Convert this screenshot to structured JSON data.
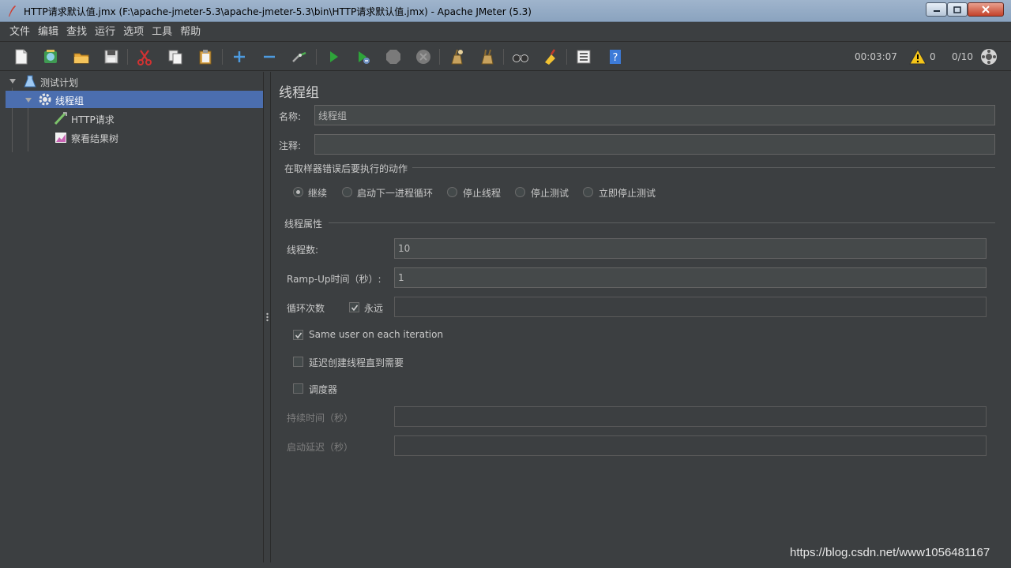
{
  "window": {
    "title": "HTTP请求默认值.jmx (F:\\apache-jmeter-5.3\\apache-jmeter-5.3\\bin\\HTTP请求默认值.jmx) - Apache JMeter (5.3)"
  },
  "menu": [
    "文件",
    "编辑",
    "查找",
    "运行",
    "选项",
    "工具",
    "帮助"
  ],
  "toolbar": {
    "icons": [
      "new-icon",
      "templates-icon",
      "open-icon",
      "save-icon",
      "cut-icon",
      "copy-icon",
      "paste-icon",
      "expand-icon",
      "collapse-icon",
      "toggle-icon",
      "start-icon",
      "start-no-pause-icon",
      "stop-icon",
      "shutdown-icon",
      "clear-icon",
      "clear-all-icon",
      "search-icon",
      "reset-search-icon",
      "function-helper-icon",
      "help-icon"
    ],
    "elapsed": "00:03:07",
    "warnings": "0",
    "threads": "0/10"
  },
  "tree": {
    "items": [
      {
        "label": "测试计划",
        "icon": "test-plan-icon"
      },
      {
        "label": "线程组",
        "icon": "thread-group-icon"
      },
      {
        "label": "HTTP请求",
        "icon": "http-sampler-icon"
      },
      {
        "label": "察看结果树",
        "icon": "result-tree-icon"
      }
    ]
  },
  "panel": {
    "title": "线程组",
    "name_label": "名称:",
    "name_value": "线程组",
    "comment_label": "注释:",
    "comment_value": "",
    "error_section": "在取样器错误后要执行的动作",
    "error_actions": [
      "继续",
      "启动下一进程循环",
      "停止线程",
      "停止测试",
      "立即停止测试"
    ],
    "error_selected": 0,
    "thread_section": "线程属性",
    "threads_label": "线程数:",
    "threads_value": "10",
    "rampup_label": "Ramp-Up时间（秒）:",
    "rampup_value": "1",
    "loop_label": "循环次数",
    "forever_label": "永远",
    "forever_checked": true,
    "loop_value": "",
    "same_user_label": "Same user on each iteration",
    "same_user_checked": true,
    "delay_label": "延迟创建线程直到需要",
    "delay_checked": false,
    "scheduler_label": "调度器",
    "scheduler_checked": false,
    "duration_label": "持续时间（秒）",
    "duration_value": "",
    "startup_delay_label": "启动延迟（秒）",
    "startup_delay_value": ""
  },
  "watermark": "https://blog.csdn.net/www1056481167"
}
